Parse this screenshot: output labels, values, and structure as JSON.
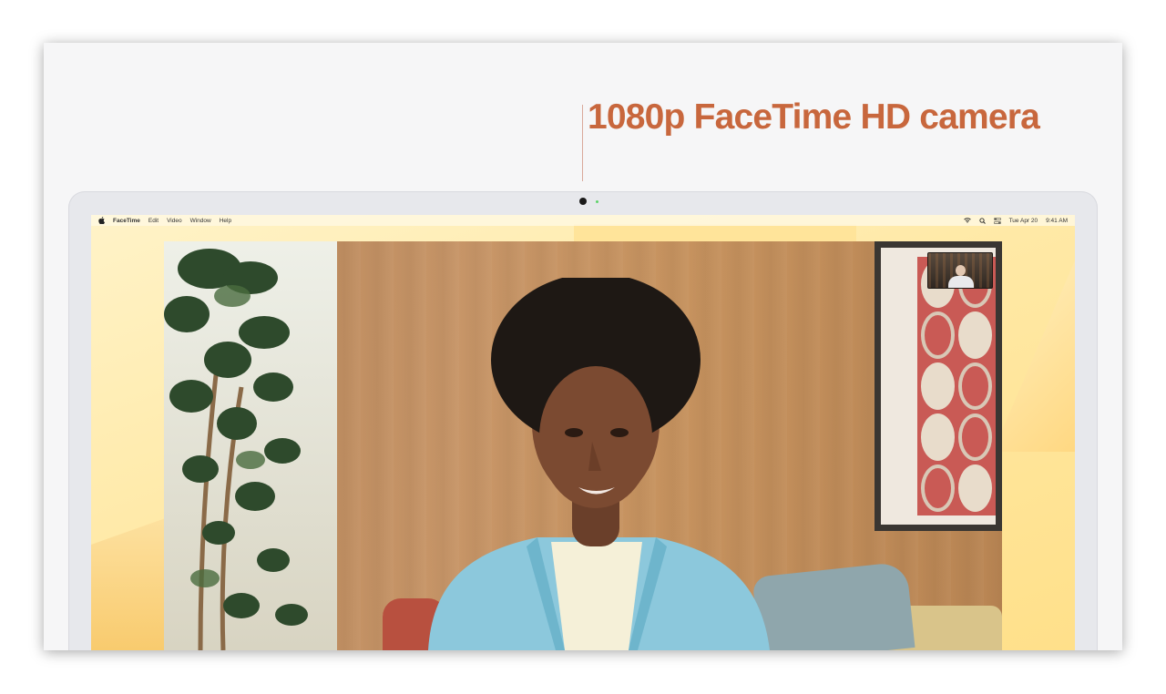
{
  "headline": "1080p FaceTime HD camera",
  "menubar": {
    "apple_icon": "apple-logo-icon",
    "items": [
      "FaceTime",
      "Edit",
      "Video",
      "Window",
      "Help"
    ],
    "status_icons": [
      "wifi-icon",
      "search-icon",
      "control-center-icon"
    ],
    "date": "Tue Apr 20",
    "time": "9:41 AM"
  },
  "colors": {
    "headline": "#c8673d",
    "wallpaper": "#ffe9a6",
    "bezel": "#e7e8ec",
    "camera_led": "#5fd36a"
  },
  "video_call": {
    "main_video": "remote-participant-video",
    "self_view": "self-view-thumbnail"
  }
}
